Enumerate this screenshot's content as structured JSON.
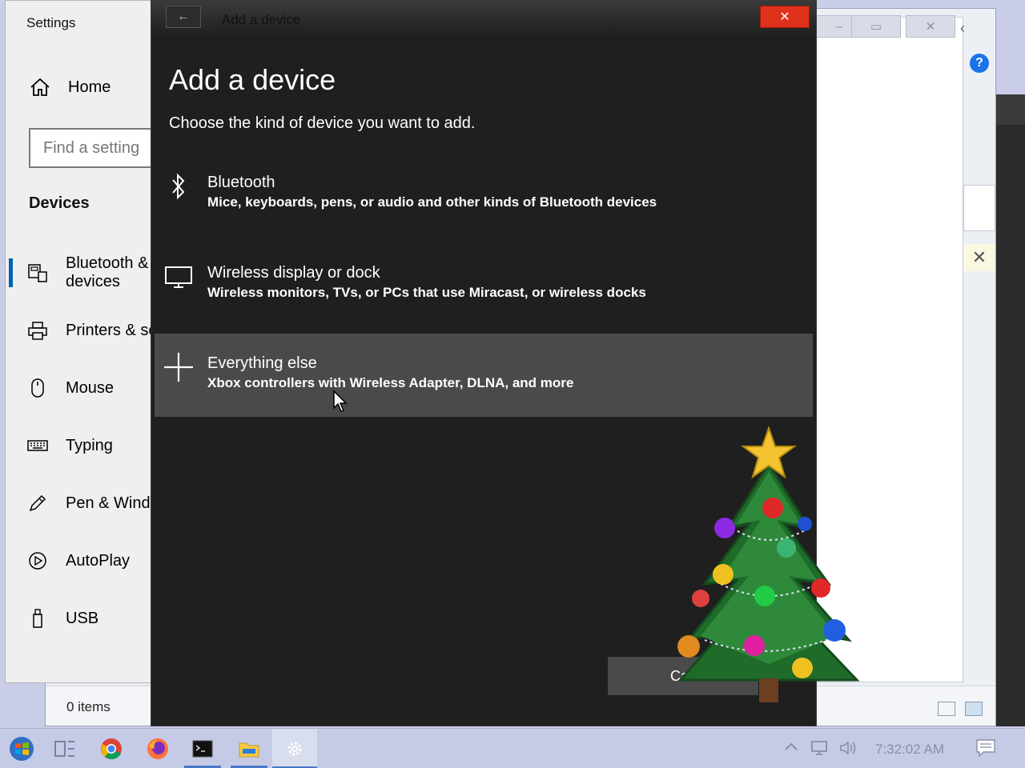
{
  "explorer": {
    "status_text": "0 items",
    "win_minimize": "‒",
    "win_maximize": "▭",
    "win_close": "✕",
    "help_glyph": "?",
    "yellow_close": "✕",
    "back_chevron": "‹"
  },
  "settings": {
    "window_title": "Settings",
    "home_label": "Home",
    "search_placeholder": "Find a setting",
    "section_title": "Devices",
    "nav_items": [
      {
        "label": "Bluetooth & other devices",
        "icon": "bluetooth-devices-icon",
        "active": true
      },
      {
        "label": "Printers & scanners",
        "icon": "printer-icon"
      },
      {
        "label": "Mouse",
        "icon": "mouse-icon"
      },
      {
        "label": "Typing",
        "icon": "keyboard-icon"
      },
      {
        "label": "Pen & Windows Ink",
        "icon": "pen-icon"
      },
      {
        "label": "AutoPlay",
        "icon": "autoplay-icon"
      },
      {
        "label": "USB",
        "icon": "usb-icon"
      }
    ]
  },
  "dialog": {
    "titlebar_text": "Add a device",
    "back_glyph": "←",
    "close_glyph": "✕",
    "heading": "Add a device",
    "subtitle": "Choose the kind of device you want to add.",
    "options": [
      {
        "title": "Bluetooth",
        "description": "Mice, keyboards, pens, or audio and other kinds of Bluetooth devices",
        "icon": "bluetooth-icon"
      },
      {
        "title": "Wireless display or dock",
        "description": "Wireless monitors, TVs, or PCs that use Miracast, or wireless docks",
        "icon": "monitor-icon"
      },
      {
        "title": "Everything else",
        "description": "Xbox controllers with Wireless Adapter, DLNA, and more",
        "icon": "plus-icon",
        "hovered": true
      }
    ],
    "cancel_label": "Cancel"
  },
  "taskbar": {
    "clock": "7:32:02 AM",
    "apps": [
      "start-button",
      "task-view-icon",
      "chrome-icon",
      "firefox-icon",
      "terminal-icon",
      "file-explorer-icon",
      "settings-icon"
    ],
    "active_app": "settings-icon"
  },
  "colors": {
    "dialog_bg": "#1f1f1f",
    "option_hover": "#4a4a4a",
    "accent": "#0063b1",
    "close_red": "#e0311b"
  }
}
